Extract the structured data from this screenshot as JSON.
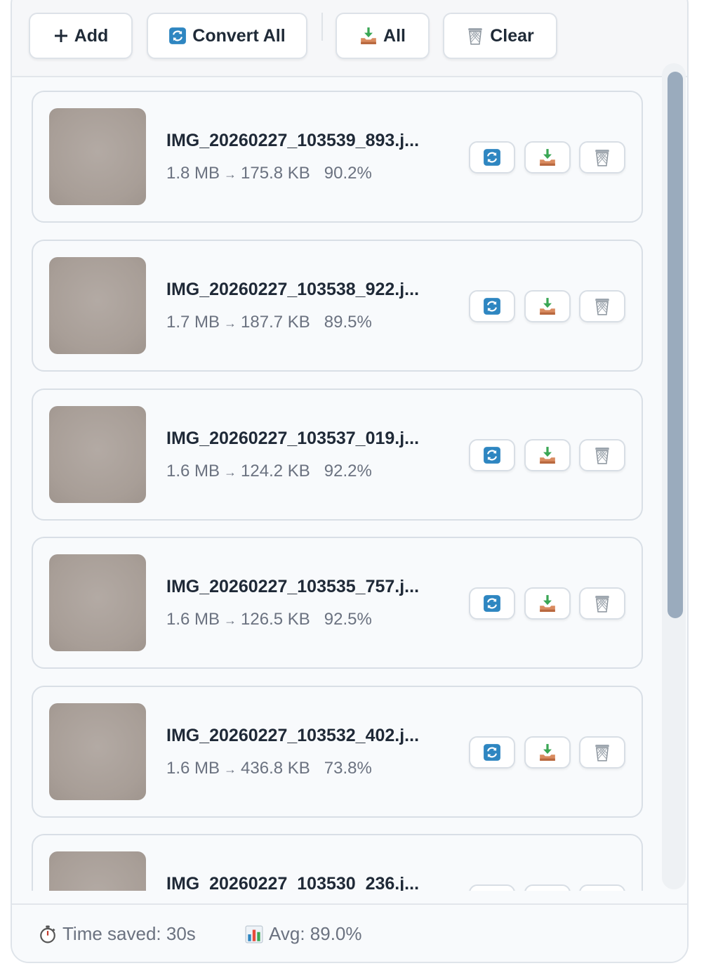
{
  "toolbar": {
    "add_label": "Add",
    "convert_all_label": "Convert All",
    "download_all_label": "All",
    "clear_label": "Clear"
  },
  "files": [
    {
      "name": "IMG_20260227_103539_893.j...",
      "original_size": "1.8 MB",
      "arrow": "→",
      "converted_size": "175.8 KB",
      "reduction": "90.2%"
    },
    {
      "name": "IMG_20260227_103538_922.j...",
      "original_size": "1.7 MB",
      "arrow": "→",
      "converted_size": "187.7 KB",
      "reduction": "89.5%"
    },
    {
      "name": "IMG_20260227_103537_019.j...",
      "original_size": "1.6 MB",
      "arrow": "→",
      "converted_size": "124.2 KB",
      "reduction": "92.2%"
    },
    {
      "name": "IMG_20260227_103535_757.j...",
      "original_size": "1.6 MB",
      "arrow": "→",
      "converted_size": "126.5 KB",
      "reduction": "92.5%"
    },
    {
      "name": "IMG_20260227_103532_402.j...",
      "original_size": "1.6 MB",
      "arrow": "→",
      "converted_size": "436.8 KB",
      "reduction": "73.8%"
    },
    {
      "name": "IMG_20260227_103530_236.j...",
      "original_size": "",
      "arrow": "",
      "converted_size": "",
      "reduction": ""
    }
  ],
  "footer": {
    "time_saved": "Time saved: 30s",
    "average": "Avg: 89.0%"
  },
  "colors": {
    "accent_blue": "#2e86c1",
    "download_green": "#3aa655",
    "download_tray": "#d98b5f"
  }
}
